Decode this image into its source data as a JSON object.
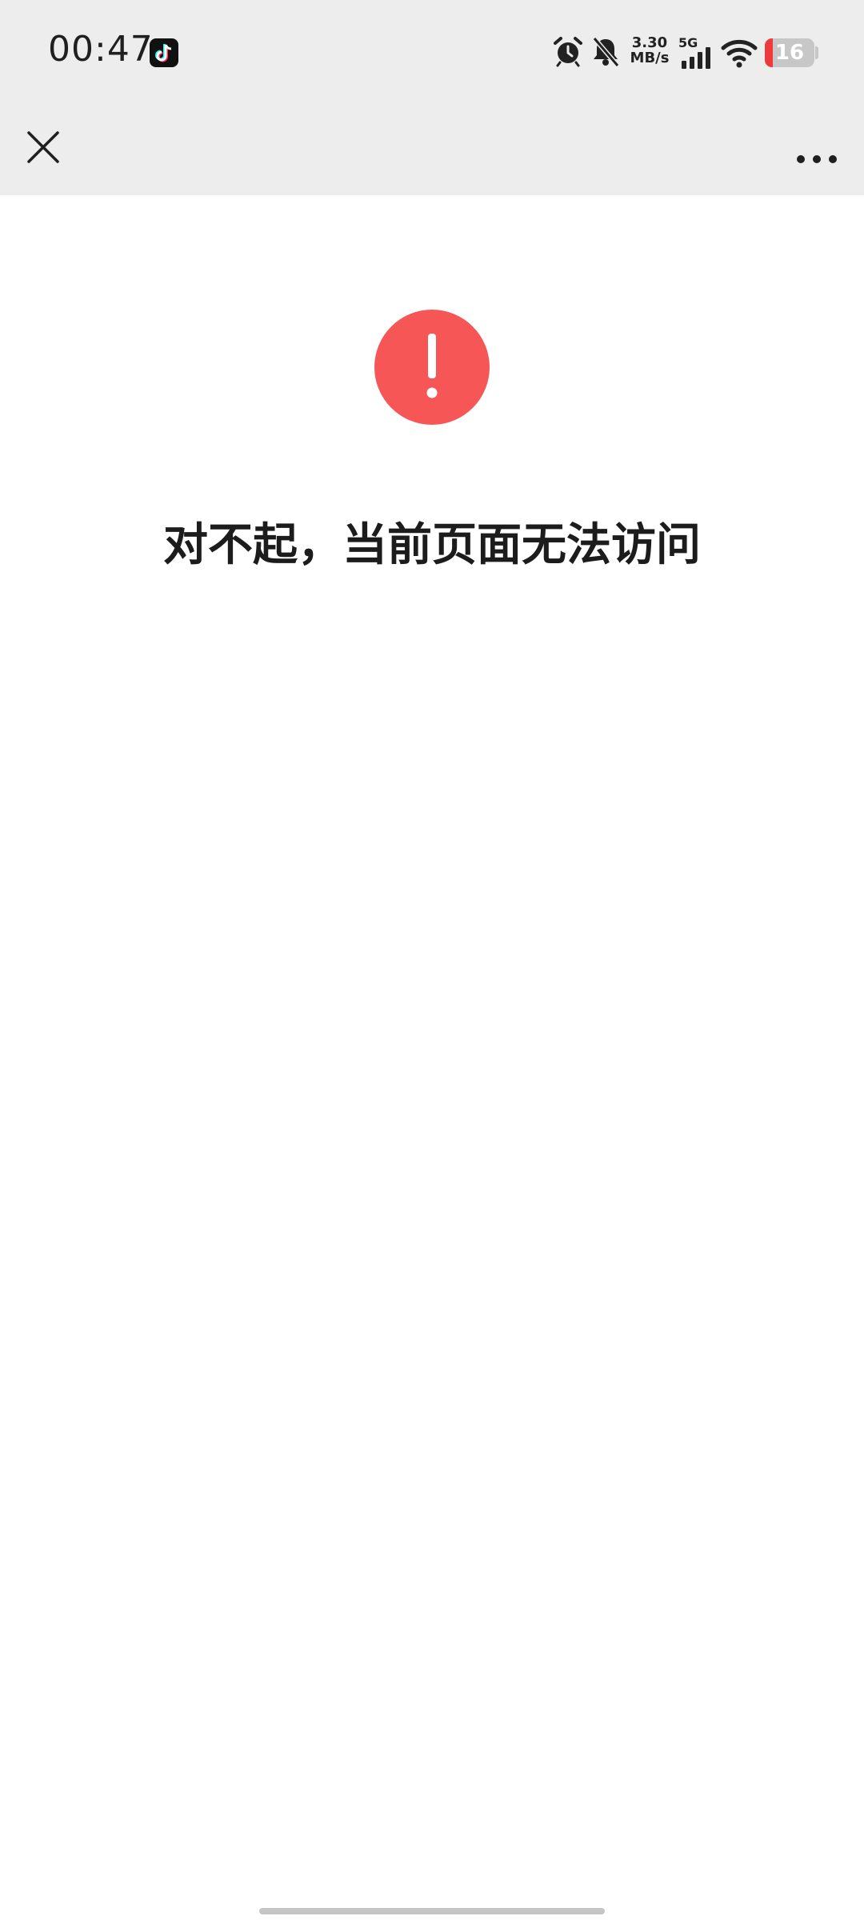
{
  "status_bar": {
    "time": "00:47",
    "network_speed_value": "3.30",
    "network_speed_unit": "MB/s",
    "network_type": "5G",
    "battery_level": "16",
    "icons": [
      "tiktok-app-icon",
      "alarm-icon",
      "mute-bell-icon",
      "signal-icon",
      "wifi-icon",
      "battery-icon"
    ]
  },
  "nav": {
    "icons": [
      "close-icon",
      "more-icon"
    ]
  },
  "content": {
    "error_icon": "exclamation-circle-icon",
    "error_color": "#f65656",
    "message": "对不起，当前页面无法访问"
  }
}
